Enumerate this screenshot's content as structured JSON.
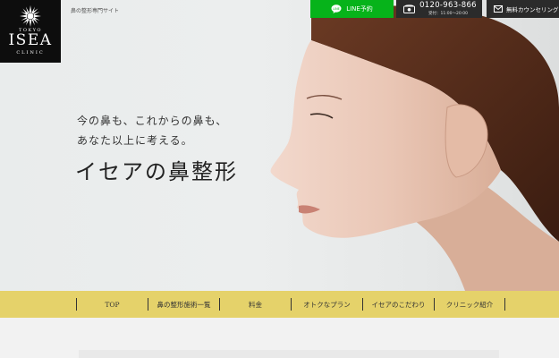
{
  "header": {
    "logo_tokyo": "TOKYO",
    "logo_name": "ISEA",
    "logo_clinic": "CLINIC",
    "site_description": "鼻の整形専門サイト"
  },
  "top_buttons": {
    "line_label": "LINE予約",
    "tel_number": "0120-963-866",
    "tel_hours": "受付：11:00〜20:00",
    "counsel_label": "無料カウンセリング"
  },
  "hero": {
    "copy_line1": "今の鼻も、これからの鼻も、",
    "copy_line2": "あなた以上に考える。",
    "title": "イセアの鼻整形"
  },
  "nav": {
    "items": [
      "TOP",
      "鼻の整形施術一覧",
      "料金",
      "オトクなプラン",
      "イセアのこだわり",
      "クリニック紹介"
    ]
  },
  "colors": {
    "nav_bg": "#e5d26a",
    "line_green": "#06b31a",
    "dark_button": "#2b2b2b",
    "logo_bg": "#0d0d0d"
  }
}
